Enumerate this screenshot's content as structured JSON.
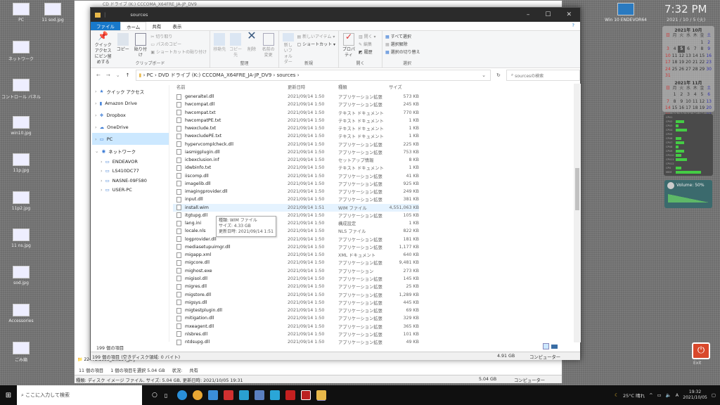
{
  "desktop": {
    "icons": [
      "PC",
      "11 sod.jpg",
      "ネットワーク",
      "コントロール パネル",
      "win10.jpg",
      "11p.jpg",
      "11p2.jpg",
      "11 ns.jpg",
      "sod.jpg",
      "Accessories",
      "ごみ箱"
    ],
    "right_icon": "Win 10 ENDEVOR64",
    "power_label": "Exit"
  },
  "clock": {
    "time": "7:32 PM",
    "date": "2021 / 10 / 5 (火)"
  },
  "calendar": {
    "weekdays": [
      "日",
      "月",
      "火",
      "水",
      "木",
      "金",
      "土"
    ],
    "months": [
      {
        "title": "2021年 10月",
        "start": 5,
        "days": 31,
        "today": 5
      },
      {
        "title": "2021年 11月",
        "start": 1,
        "days": 30
      }
    ]
  },
  "cpu_meter": {
    "labels": [
      "CPU1",
      "CPU2",
      "CPU3",
      "CPU4",
      "CPU5",
      "CPU6",
      "CPU7",
      "CPU8",
      "CPU9",
      "CPU10",
      "CPU11",
      "CPU12",
      "CPU",
      "MEM"
    ],
    "levels": [
      0,
      3,
      1,
      4,
      0,
      2,
      3,
      1,
      3,
      2,
      4,
      0,
      2,
      9
    ]
  },
  "volume": {
    "label": "Volume: 50%",
    "level": 50
  },
  "back_window": {
    "title": "CD ドライブ (K:) CCCOMA_X64FRE_JA-JP_DV9",
    "folder_item": "22471.1000_amd64_ja-j",
    "status_left": "11 個の項目",
    "status_sel": "1 個の項目を選択  5.04 GB",
    "status_state": "状況:",
    "status_share": "共有",
    "details": "種類: ディスク イメージ ファイル, サイズ: 5.04 GB, 更新日時: 2021/10/05 19:31",
    "details_size": "5.04 GB",
    "details_loc": "コンピューター"
  },
  "window": {
    "title": "sources",
    "tabs": [
      "ファイル",
      "ホーム",
      "共有",
      "表示"
    ],
    "ribbon": {
      "pin": "クイック アクセスにピン留めする",
      "copy": "コピー",
      "paste": "貼り付け",
      "cut": "切り取り",
      "copy_path": "パスのコピー",
      "paste_shortcut": "ショートカットの貼り付け",
      "clipboard": "クリップボード",
      "move_to": "移動先",
      "copy_to": "コピー先",
      "delete": "削除",
      "rename": "名前の変更",
      "organize": "整理",
      "new_folder": "新しいフォルダー",
      "new_item": "新しいアイテム",
      "shortcut": "ショートカット",
      "new": "新規",
      "properties": "プロパティ",
      "open": "開く",
      "edit": "編集",
      "history": "履歴",
      "open_group": "開く",
      "select_all": "すべて選択",
      "select_none": "選択解除",
      "invert": "選択の切り替え",
      "select": "選択"
    },
    "breadcrumb": [
      "PC",
      "DVD ドライブ (K:) CCCOMA_X64FRE_JA-JP_DV9",
      "sources"
    ],
    "search_placeholder": "sourcesの検索",
    "nav": [
      {
        "label": "クイック アクセス"
      },
      {
        "label": "Amazon Drive"
      },
      {
        "label": "Dropbox"
      },
      {
        "label": "OneDrive"
      },
      {
        "label": "PC",
        "selected": true
      },
      {
        "label": "ネットワーク"
      }
    ],
    "network": [
      "ENDEAVOR",
      "LS410DC77",
      "NASNE-09F580",
      "USER-PC"
    ],
    "columns": [
      "名前",
      "更新日時",
      "種類",
      "サイズ"
    ],
    "files": [
      [
        "generaltel.dll",
        "2021/09/14 1:50",
        "アプリケーション拡張",
        "573 KB"
      ],
      [
        "hwcompat.dll",
        "2021/09/14 1:50",
        "アプリケーション拡張",
        "245 KB"
      ],
      [
        "hwcompat.txt",
        "2021/09/14 1:50",
        "テキスト ドキュメント",
        "770 KB"
      ],
      [
        "hwcompatPE.txt",
        "2021/09/14 1:50",
        "テキスト ドキュメント",
        "1 KB"
      ],
      [
        "hwexclude.txt",
        "2021/09/14 1:50",
        "テキスト ドキュメント",
        "1 KB"
      ],
      [
        "hwexcludePE.txt",
        "2021/09/14 1:50",
        "テキスト ドキュメント",
        "1 KB"
      ],
      [
        "hypervcomplcheck.dll",
        "2021/09/14 1:50",
        "アプリケーション拡張",
        "225 KB"
      ],
      [
        "iasmigplugin.dll",
        "2021/09/14 1:50",
        "アプリケーション拡張",
        "753 KB"
      ],
      [
        "icbexclusion.inf",
        "2021/09/14 1:50",
        "セットアップ情報",
        "8 KB"
      ],
      [
        "idwbinfo.txt",
        "2021/09/14 1:50",
        "テキスト ドキュメント",
        "1 KB"
      ],
      [
        "iiscomp.dll",
        "2021/09/14 1:50",
        "アプリケーション拡張",
        "41 KB"
      ],
      [
        "imagelib.dll",
        "2021/09/14 1:50",
        "アプリケーション拡張",
        "925 KB"
      ],
      [
        "imagingprovider.dll",
        "2021/09/14 1:50",
        "アプリケーション拡張",
        "249 KB"
      ],
      [
        "input.dll",
        "2021/09/14 1:50",
        "アプリケーション拡張",
        "381 KB"
      ],
      [
        "install.wim",
        "2021/09/14 1:51",
        "WIM ファイル",
        "4,551,063 KB"
      ],
      [
        "itgtupg.dll",
        "2021/09/14 1:50",
        "アプリケーション拡張",
        "105 KB"
      ],
      [
        "lang.ini",
        "2021/09/14 1:50",
        "構成設定",
        "1 KB"
      ],
      [
        "locale.nls",
        "2021/09/14 1:50",
        "NLS ファイル",
        "822 KB"
      ],
      [
        "logprovider.dll",
        "2021/09/14 1:50",
        "アプリケーション拡張",
        "181 KB"
      ],
      [
        "mediasetupuimgr.dll",
        "2021/09/14 1:50",
        "アプリケーション拡張",
        "1,177 KB"
      ],
      [
        "migapp.xml",
        "2021/09/14 1:50",
        "XML ドキュメント",
        "640 KB"
      ],
      [
        "migcore.dll",
        "2021/09/14 1:50",
        "アプリケーション拡張",
        "9,481 KB"
      ],
      [
        "mighost.exe",
        "2021/09/14 1:50",
        "アプリケーション",
        "273 KB"
      ],
      [
        "migisol.dll",
        "2021/09/14 1:50",
        "アプリケーション拡張",
        "145 KB"
      ],
      [
        "migres.dll",
        "2021/09/14 1:50",
        "アプリケーション拡張",
        "25 KB"
      ],
      [
        "migstore.dll",
        "2021/09/14 1:50",
        "アプリケーション拡張",
        "1,289 KB"
      ],
      [
        "migsys.dll",
        "2021/09/14 1:50",
        "アプリケーション拡張",
        "445 KB"
      ],
      [
        "migtestplugin.dll",
        "2021/09/14 1:50",
        "アプリケーション拡張",
        "69 KB"
      ],
      [
        "mitigation.dll",
        "2021/09/14 1:50",
        "アプリケーション拡張",
        "329 KB"
      ],
      [
        "mxeagent.dll",
        "2021/09/14 1:50",
        "アプリケーション拡張",
        "365 KB"
      ],
      [
        "nlsbres.dll",
        "2021/09/14 1:50",
        "アプリケーション拡張",
        "101 KB"
      ],
      [
        "ntdsupg.dll",
        "2021/09/14 1:50",
        "アプリケーション拡張",
        "49 KB"
      ]
    ],
    "tooltip": [
      "種類: WIM ファイル",
      "サイズ: 4.33 GB",
      "更新日時: 2021/09/14 1:51"
    ],
    "status_items": "199 個の項目",
    "details": "199 個の項目 (空きディスク領域: 0 バイト)",
    "details_size": "4.91 GB",
    "details_loc": "コンピューター"
  },
  "taskbar": {
    "search_placeholder": "ここに入力して検索",
    "weather": "25°C 晴れ",
    "time": "19:32",
    "date": "2021/10/05"
  }
}
